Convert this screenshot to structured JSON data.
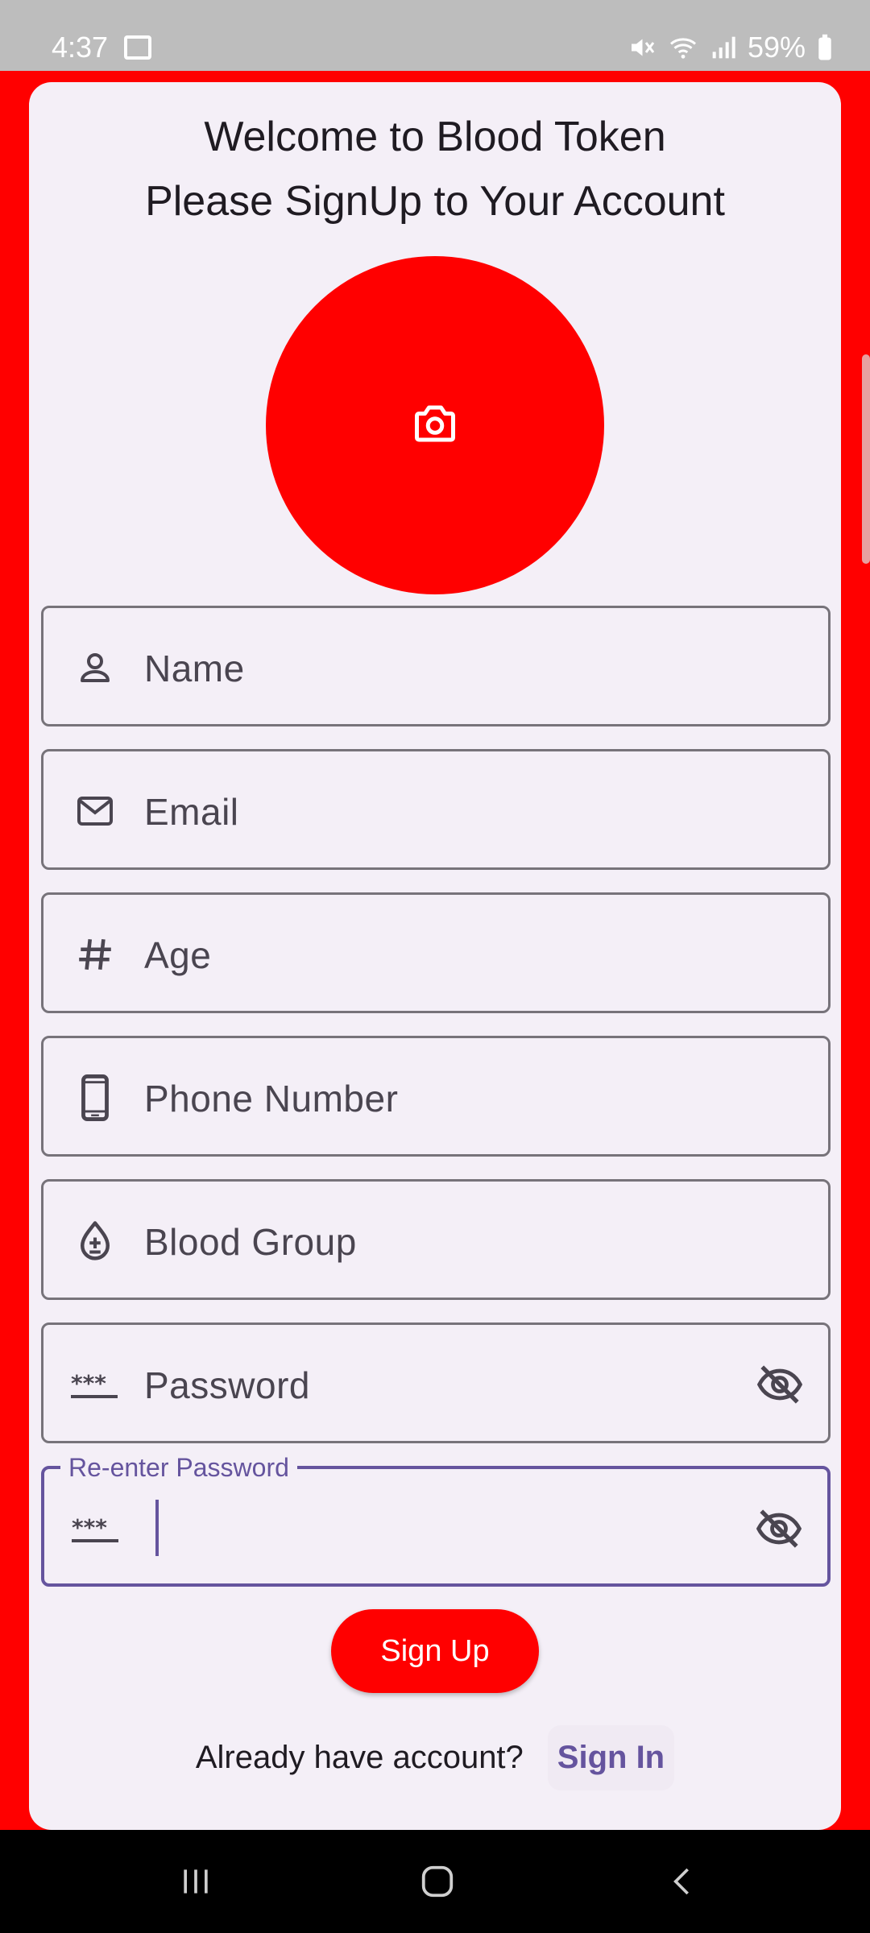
{
  "status_bar": {
    "time": "4:37",
    "battery": "59%",
    "icons": [
      "gallery-icon",
      "mute-icon",
      "wifi-icon",
      "signal-icon",
      "battery-icon"
    ]
  },
  "header": {
    "title_line1": "Welcome to Blood Token",
    "title_line2": "Please SignUp to Your Account"
  },
  "avatar": {
    "icon": "camera-icon",
    "color": "#ff0000"
  },
  "fields": {
    "name": {
      "label": "Name",
      "icon": "person-icon"
    },
    "email": {
      "label": "Email",
      "icon": "mail-icon"
    },
    "age": {
      "label": "Age",
      "icon": "hash-icon"
    },
    "phone": {
      "label": "Phone Number",
      "icon": "phone-icon"
    },
    "blood_group": {
      "label": "Blood Group",
      "icon": "blood-drop-icon"
    },
    "password": {
      "label": "Password",
      "icon": "password-icon",
      "toggle_icon": "visibility-off-icon"
    },
    "reenter_password": {
      "label": "Re-enter Password",
      "value": "",
      "icon": "password-icon",
      "toggle_icon": "visibility-off-icon"
    }
  },
  "actions": {
    "signup_label": "Sign Up",
    "account_prompt": "Already have account?",
    "signin_label": "Sign In"
  },
  "colors": {
    "background": "#ff0000",
    "card": "#f4eff7",
    "accent": "#65549e",
    "button": "#ff0000"
  },
  "nav_bar": {
    "items": [
      "recents-icon",
      "home-icon",
      "back-icon"
    ]
  }
}
